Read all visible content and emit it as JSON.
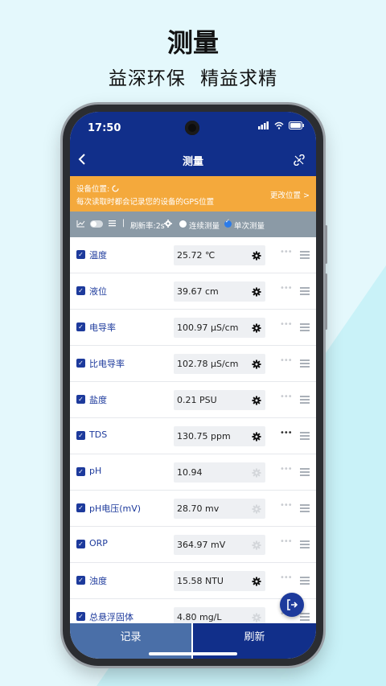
{
  "promo": {
    "title": "测量",
    "subtitle": "益深环保 精益求精"
  },
  "status_bar": {
    "time": "17:50"
  },
  "navbar": {
    "title": "测量"
  },
  "location": {
    "label": "设备位置:",
    "note": "每次读取时都会记录您的设备的GPS位置",
    "change": "更改位置 >"
  },
  "toolbar": {
    "refresh_rate": "刷新率:2s",
    "continuous": "连续测量",
    "single": "单次测量"
  },
  "rows": [
    {
      "name": "温度",
      "value": "25.72 ℃",
      "gear_active": true,
      "dots_active": false
    },
    {
      "name": "液位",
      "value": "39.67 cm",
      "gear_active": true,
      "dots_active": false
    },
    {
      "name": "电导率",
      "value": "100.97 μS/cm",
      "gear_active": true,
      "dots_active": false
    },
    {
      "name": "比电导率",
      "value": "102.78 μS/cm",
      "gear_active": true,
      "dots_active": false
    },
    {
      "name": "盐度",
      "value": "0.21 PSU",
      "gear_active": true,
      "dots_active": false
    },
    {
      "name": "TDS",
      "value": "130.75 ppm",
      "gear_active": true,
      "dots_active": true
    },
    {
      "name": "pH",
      "value": "10.94",
      "gear_active": false,
      "dots_active": false
    },
    {
      "name": "pH电压(mV)",
      "value": "28.70 mv",
      "gear_active": false,
      "dots_active": false
    },
    {
      "name": "ORP",
      "value": "364.97 mV",
      "gear_active": false,
      "dots_active": false
    },
    {
      "name": "浊度",
      "value": "15.58 NTU",
      "gear_active": true,
      "dots_active": false
    },
    {
      "name": "总悬浮固体",
      "value": "4.80 mg/L",
      "gear_active": false,
      "dots_active": false
    }
  ],
  "bottom": {
    "record": "记录",
    "refresh": "刷新"
  },
  "colors": {
    "nav_blue": "#112f8a",
    "accent_orange": "#f4a93c",
    "toolbar_gray": "#8b9aa6",
    "record_blue": "#4a6fa8",
    "background": "#e4f8fc"
  }
}
